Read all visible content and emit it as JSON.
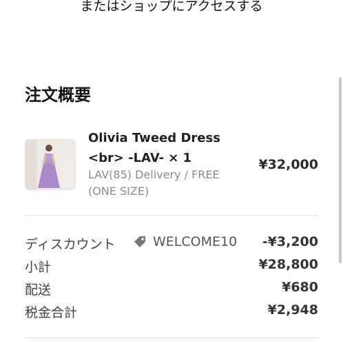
{
  "header": {
    "link_text": "またはショップにアクセスする"
  },
  "summary": {
    "title": "注文概要"
  },
  "item": {
    "name": "Olivia Tweed Dress <br> -LAV- × 1",
    "variant": "LAV(85) Delivery / FREE (ONE SIZE)",
    "price": "¥32,000"
  },
  "totals": {
    "discount_label": "ディスカウント",
    "discount_code": "WELCOME10",
    "discount_value": "-¥3,200",
    "subtotal_label": "小計",
    "subtotal_value": "¥28,800",
    "shipping_label": "配送",
    "shipping_value": "¥680",
    "tax_label": "税金合計",
    "tax_value": "¥2,948"
  },
  "colors": {
    "accent_text": "#222222",
    "muted_text": "#8a8a8a",
    "divider": "#e3e3e3"
  },
  "icons": {
    "discount_tag": "tag-icon"
  }
}
